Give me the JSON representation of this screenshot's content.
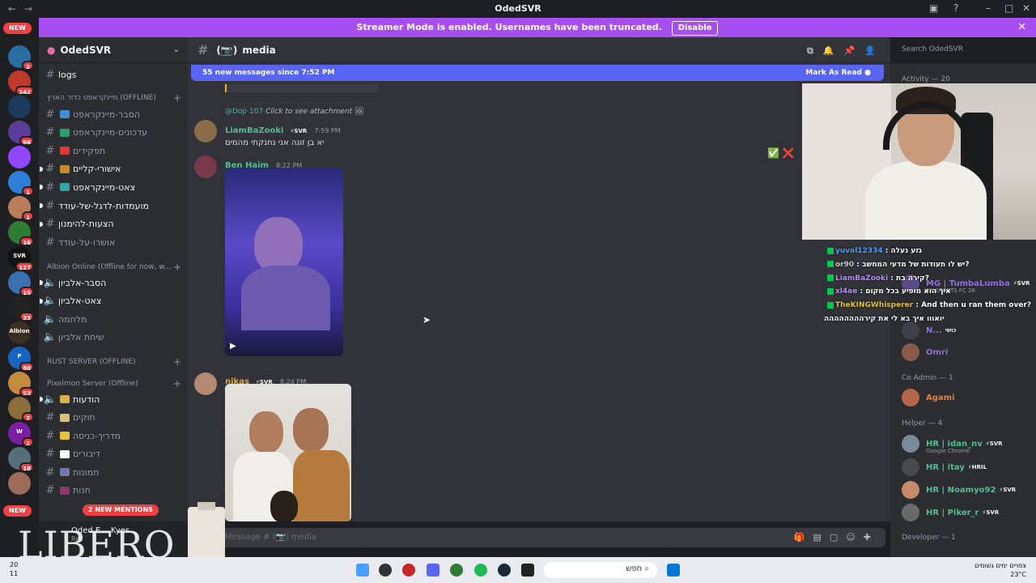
{
  "titlebar": {
    "title": "OdedSVR"
  },
  "banner": {
    "text": "Streamer Mode is enabled. Usernames have been truncated.",
    "disable_label": "Disable"
  },
  "rail": {
    "new_top": "NEW",
    "new_bottom": "NEW",
    "servers": [
      {
        "badge": "2",
        "color": "#2b6ca3"
      },
      {
        "badge": "142",
        "color": "#c0392b"
      },
      {
        "badge": "",
        "color": "#1d3b5e"
      },
      {
        "badge": "66",
        "color": "#5a3f9a"
      },
      {
        "badge": "",
        "color": "#9146ff"
      },
      {
        "badge": "1",
        "color": "#2f7ed8"
      },
      {
        "badge": "1",
        "color": "#b87d5b"
      },
      {
        "badge": "16",
        "color": "#2e7d32"
      },
      {
        "badge": "127",
        "color": "#111111",
        "label": "SVR"
      },
      {
        "badge": "15",
        "color": "#3a6fb0"
      },
      {
        "badge": "33",
        "color": "#222222"
      },
      {
        "badge": "",
        "color": "#3b2f22",
        "label": "Albion"
      },
      {
        "badge": "80",
        "color": "#1565c0",
        "label": "P"
      },
      {
        "badge": "53",
        "color": "#c58b3d"
      },
      {
        "badge": "7",
        "color": "#8a6d3b"
      },
      {
        "badge": "2",
        "color": "#7b1fa2",
        "label": "W"
      },
      {
        "badge": "18",
        "color": "#546e7a"
      },
      {
        "badge": "",
        "color": "#9e6b5a"
      }
    ]
  },
  "sidebar": {
    "server_name": "OdedSVR",
    "logs": "logs",
    "cat1": "מיינקראפט כדור הארץ (OFFLINE)",
    "cat2": "Albion Online (Offline for now, w...",
    "cat3": "RUST SERVER (OFFLINE)",
    "cat4": "Pixelmon Server (Offline)",
    "channels1": [
      {
        "label": "הסבר-מיינקראפט",
        "color": "#3f8fd8"
      },
      {
        "label": "עדכונים-מיינקראפט",
        "color": "#2e9e6b"
      },
      {
        "label": "תפקידים",
        "color": "#d83a3a"
      },
      {
        "label": "אישורי-קליים",
        "color": "#c98a2a"
      },
      {
        "label": "צאט-מיינקראפט",
        "color": "#35a3a3"
      }
    ],
    "channels1b": [
      "מועמדות-לדגל-של-עודד",
      "הצעות-להימנון",
      "אושרו-על-עודד"
    ],
    "channels2": [
      "הסבר-אלביון",
      "צאט-אלביון",
      "מלחמה",
      "שיחת אלביון"
    ],
    "channels4": [
      {
        "label": "הודעות",
        "color": "#d6b34a"
      },
      {
        "label": "חוקים",
        "color": "#d8c07a"
      },
      {
        "label": "מדריך-כניסה",
        "color": "#e8c23a"
      },
      {
        "label": "דיבורים",
        "color": "#ffffff"
      },
      {
        "label": "תמונות",
        "color": "#6d7ba8"
      },
      {
        "label": "חנות",
        "color": "#8a3b6b"
      }
    ],
    "mentions": "2 NEW MENTIONS",
    "user_name": "Oded E... Kyes",
    "user_status": "Rec"
  },
  "chat": {
    "channel_name": "media",
    "channel_emoji": "(📷)",
    "new_messages": "55 new messages since 7:52 PM",
    "mark_as_read": "Mark As Read",
    "reply_user": "@Dop 107",
    "reply_text": "Click to see attachment",
    "messages": [
      {
        "user": "LiamBaZooki",
        "color": "#4fbf8f",
        "tag": "⚡SVR",
        "time": "7:59 PM",
        "text": "יא בן זונה אני נחנקתי מהמים"
      },
      {
        "user": "Ben Haim",
        "color": "#4fbf8f",
        "tag": "",
        "time": "8:22 PM",
        "text": ""
      },
      {
        "user": "nikas",
        "color": "#e0a33a",
        "tag": "⚡SVR",
        "time": "8:24 PM",
        "text": ""
      }
    ],
    "input_placeholder": "Message # (📷) media"
  },
  "search": {
    "placeholder": "Search OdedSVR"
  },
  "members": {
    "activity": "Activity — 20",
    "co_admin": "Co Admin — 1",
    "helper": "Helper — 4",
    "developer": "Developer — 1",
    "items": [
      {
        "name": "MG | TumbaLumba",
        "tag": "⚡SVR",
        "sub": "EA SPORTS FC 26",
        "color": "#8c6fd6"
      },
      {
        "name": "N...",
        "tag": "כושי",
        "sub": "",
        "color": "#8c6fd6"
      },
      {
        "name": "Omri",
        "tag": "",
        "sub": "",
        "color": "#8c6fd6"
      },
      {
        "name": "Agami",
        "tag": "",
        "sub": "",
        "color": "#e67e3c"
      },
      {
        "name": "HR | idan_nv",
        "tag": "⚡SVR",
        "sub": "Google Chrome",
        "color": "#4fbf8f"
      },
      {
        "name": "HR | itay",
        "tag": "⚡HRIL",
        "sub": "",
        "color": "#4fbf8f"
      },
      {
        "name": "HR | Noamyo92",
        "tag": "⚡SVR",
        "sub": "",
        "color": "#4fbf8f"
      },
      {
        "name": "HR | Piker_r",
        "tag": "⚡SVR",
        "sub": "",
        "color": "#4fbf8f"
      }
    ]
  },
  "overlay_chat": [
    {
      "user": "yuval12334",
      "color": "#4aa0ff",
      "text": "גזע נעלה"
    },
    {
      "user": "or90",
      "color": "#cccccc",
      "text": "יש לו תעודות של מדעי המחשב?"
    },
    {
      "user": "LiamBaZooki",
      "color": "#b58cff",
      "text": "קירה בת?"
    },
    {
      "user": "xl4ae",
      "color": "#b58cff",
      "text": "איך הוא מופיע בכל מקום"
    },
    {
      "user": "TheKINGWhisperer",
      "color": "#e0c23a",
      "text": "And then u ran them over?"
    }
  ],
  "overlay_last": "יואווו איך בא לי את קירהההההההה",
  "watermark": "LIBERO",
  "taskbar": {
    "date1": "20",
    "date2": "11",
    "search_label": "חפש",
    "weather1": "צפויים ימים גשומים",
    "weather2": "23°C"
  }
}
